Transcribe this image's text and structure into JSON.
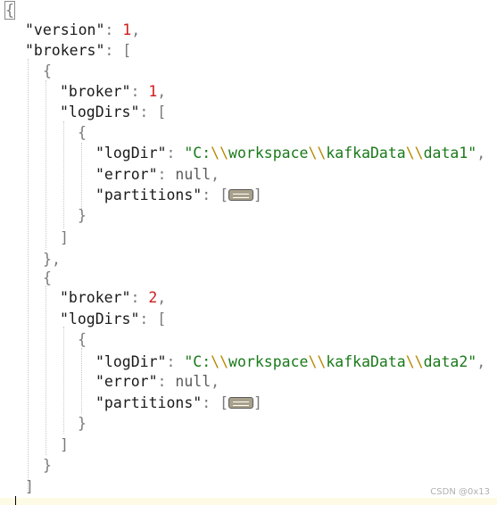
{
  "json_view": {
    "brace_open": "{",
    "brace_close": "}",
    "bracket_open": "[",
    "bracket_close": "]",
    "colon": ":",
    "comma": ",",
    "version_key": "\"version\"",
    "version_value": "1",
    "brokers_key": "\"brokers\"",
    "broker_key": "\"broker\"",
    "logdirs_key": "\"logDirs\"",
    "logdir_key": "\"logDir\"",
    "error_key": "\"error\"",
    "partitions_key": "\"partitions\"",
    "null_value": "null",
    "entries": [
      {
        "broker_value": "1",
        "logdir_prefix": "\"C:",
        "logdir_parts": [
          "workspace",
          "kafkaData",
          "data1\""
        ]
      },
      {
        "broker_value": "2",
        "logdir_prefix": "\"C:",
        "logdir_parts": [
          "workspace",
          "kafkaData",
          "data2\""
        ]
      }
    ],
    "escape_sequence": "\\\\",
    "collapsed_icon": "collapsed-array-icon"
  },
  "watermark": "CSDN @0x13"
}
